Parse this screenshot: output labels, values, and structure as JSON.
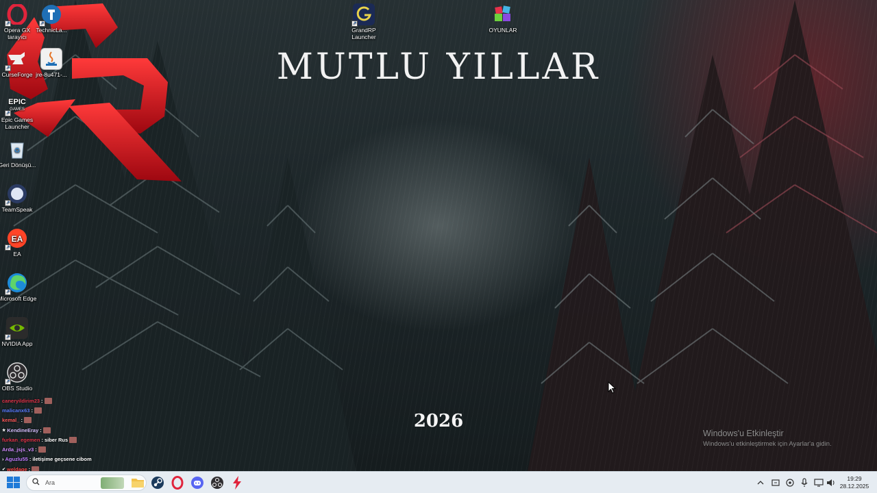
{
  "wallpaper": {
    "headline": "MUTLU YILLAR",
    "year": "2026"
  },
  "desktop_icons": [
    {
      "label": "Opera GX tarayıcı",
      "icon": "opera-gx-icon"
    },
    {
      "label": "TechnicLa...",
      "icon": "technic-launcher-icon"
    },
    {
      "label": "CurseForge",
      "icon": "curseforge-icon"
    },
    {
      "label": "jre-8u471-...",
      "icon": "java-installer-icon"
    },
    {
      "label": "Epic Games Launcher",
      "icon": "epic-games-icon"
    },
    {
      "label": "Geri Dönüşü...",
      "icon": "recycle-bin-icon"
    },
    {
      "label": "TeamSpeak",
      "icon": "teamspeak-icon"
    },
    {
      "label": "EA",
      "icon": "ea-icon"
    },
    {
      "label": "Microsoft Edge",
      "icon": "edge-icon"
    },
    {
      "label": "NVIDIA App",
      "icon": "nvidia-icon"
    },
    {
      "label": "OBS Studio",
      "icon": "obs-icon"
    },
    {
      "label": "GrandRP Launcher",
      "icon": "grandrp-launcher-icon"
    },
    {
      "label": "OYUNLAR",
      "icon": "folder-games-icon"
    }
  ],
  "chat": [
    {
      "user": "caneryildirim23",
      "message": "",
      "color": "#e0344a"
    },
    {
      "user": "malicanx63",
      "message": "",
      "color": "#5a7dff"
    },
    {
      "user": "kemal_",
      "message": "",
      "color": "#ff5a5a"
    },
    {
      "user": "KendineEray",
      "message": "",
      "color": "#d5c0ff"
    },
    {
      "user": "furkan_egemen",
      "message": "siber Rus",
      "color": "#e0344a"
    },
    {
      "user": "Arda_jsjs_v3",
      "message": "",
      "color": "#d28cff"
    },
    {
      "user": "Aguzlu55",
      "message": "iletişime geçsene cibom",
      "color": "#c07cff"
    },
    {
      "user": "weldage",
      "message": "",
      "color": "#ff4a4a"
    }
  ],
  "activation_watermark": {
    "title": "Windows'u Etkinleştir",
    "subtitle": "Windows'u etkinleştirmek için Ayarlar'a gidin."
  },
  "taskbar": {
    "search_placeholder": "Ara",
    "pinned_apps": [
      "file-explorer-icon",
      "steam-icon",
      "opera-gx-icon",
      "discord-icon",
      "obs-icon",
      "app-bolt-icon"
    ],
    "tray_icons": [
      "chevron-up-icon",
      "sync-icon",
      "network-settings-icon",
      "microphone-icon",
      "display-icon",
      "volume-icon"
    ],
    "time": "19:29",
    "date": "28.12.2025"
  }
}
